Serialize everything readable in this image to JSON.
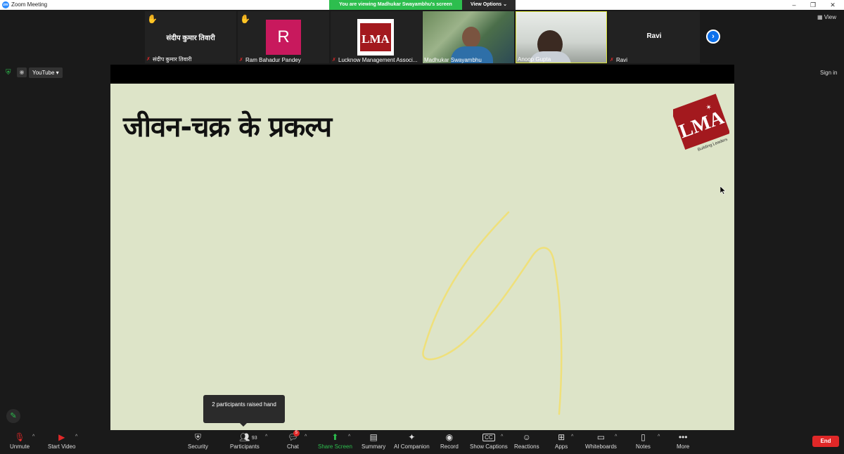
{
  "window": {
    "title": "Zoom Meeting",
    "app_logo_text": "zm"
  },
  "share_banner": {
    "message": "You are viewing Madhukar Swayambhu's screen",
    "view_options": "View Options"
  },
  "thumbnails": [
    {
      "center_name": "संदीप कुमार तिवारी",
      "label": "संदीप कुमार तिवारी",
      "hand_raised": true,
      "muted": true
    },
    {
      "avatar_letter": "R",
      "label": "Ram Bahadur Pandey",
      "hand_raised": true,
      "muted": true
    },
    {
      "label": "Lucknow Management Associ...",
      "muted": true,
      "logo_text": "LMA"
    },
    {
      "label": "Madhukar Swayambhu",
      "muted": false
    },
    {
      "label": "Anoop Gupta",
      "muted": false
    },
    {
      "center_name": "Ravi",
      "label": "Ravi",
      "muted": true
    }
  ],
  "view_button": "View",
  "youtube_button": "YouTube",
  "sign_in": "Sign in",
  "slide": {
    "title": "जीवन-चक्र के प्रकल्प",
    "logo_text": "LMA",
    "logo_tagline": "Building Leaders"
  },
  "tooltip": "2 participants raised hand",
  "toolbar": {
    "unmute": "Unmute",
    "start_video": "Start Video",
    "security": "Security",
    "participants": "Participants",
    "participants_count": "93",
    "chat": "Chat",
    "chat_badge": "5",
    "share_screen": "Share Screen",
    "summary": "Summary",
    "ai_companion": "AI Companion",
    "record": "Record",
    "show_captions": "Show Captions",
    "captions_icon": "CC",
    "reactions": "Reactions",
    "apps": "Apps",
    "whiteboards": "Whiteboards",
    "notes": "Notes",
    "more": "More",
    "end": "End"
  },
  "colors": {
    "accent_green": "#2dbe4e",
    "end_red": "#e02828",
    "slide_bg": "#dde4c8",
    "lma_red": "#a3191e"
  }
}
